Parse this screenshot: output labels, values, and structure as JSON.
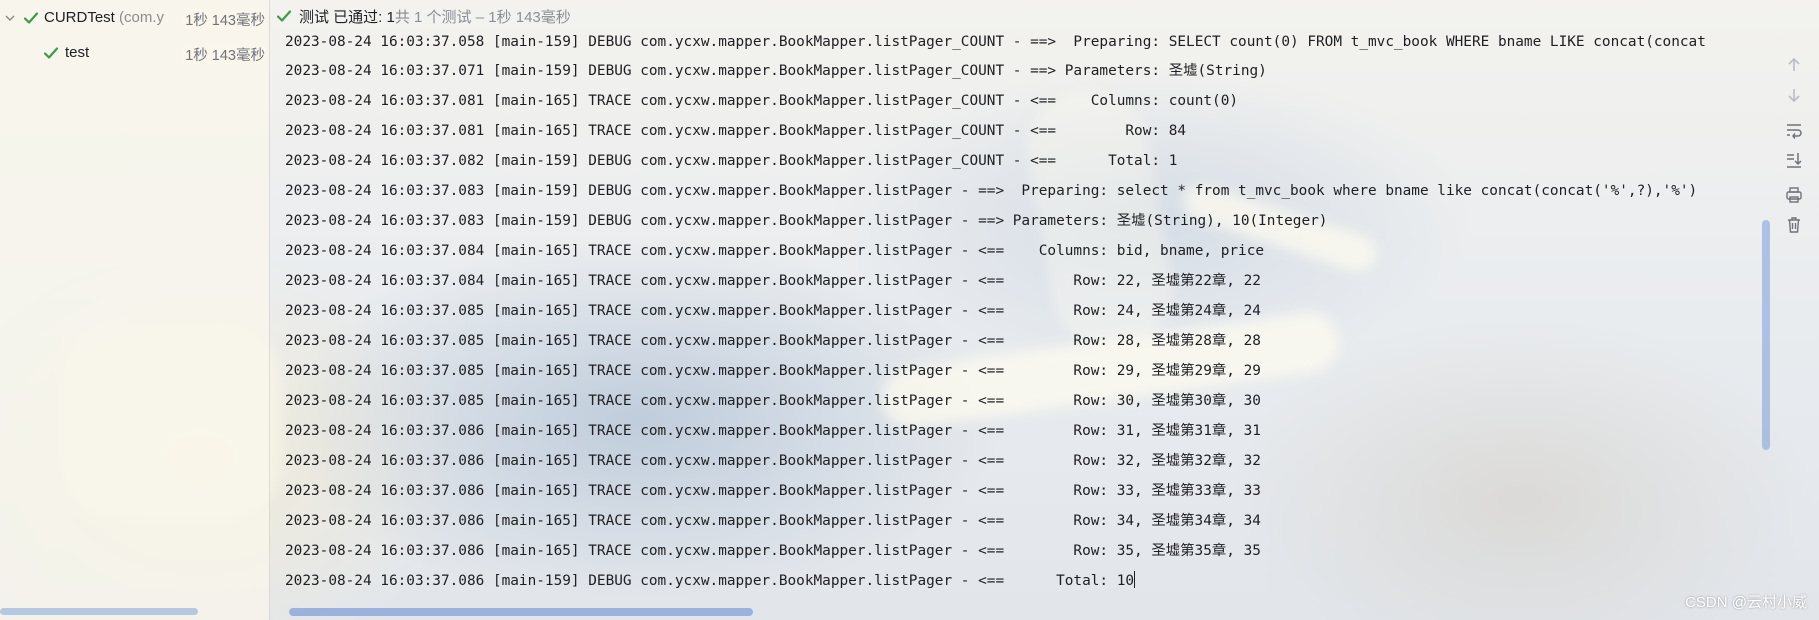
{
  "test_tree": {
    "root": {
      "name": "CURDTest",
      "package": "(com.y",
      "time": "1秒 143毫秒"
    },
    "child": {
      "name": "test",
      "time": "1秒 143毫秒"
    }
  },
  "status_bar": {
    "label": "测试 已通过: 1",
    "summary": "共 1 个测试 – 1秒 143毫秒"
  },
  "console": {
    "lines": [
      "2023-08-24 16:03:37.058 [main-159] DEBUG com.ycxw.mapper.BookMapper.listPager_COUNT - ==>  Preparing: SELECT count(0) FROM t_mvc_book WHERE bname LIKE concat(concat",
      "2023-08-24 16:03:37.071 [main-159] DEBUG com.ycxw.mapper.BookMapper.listPager_COUNT - ==> Parameters: 圣墟(String)",
      "2023-08-24 16:03:37.081 [main-165] TRACE com.ycxw.mapper.BookMapper.listPager_COUNT - <==    Columns: count(0)",
      "2023-08-24 16:03:37.081 [main-165] TRACE com.ycxw.mapper.BookMapper.listPager_COUNT - <==        Row: 84",
      "2023-08-24 16:03:37.082 [main-159] DEBUG com.ycxw.mapper.BookMapper.listPager_COUNT - <==      Total: 1",
      "2023-08-24 16:03:37.083 [main-159] DEBUG com.ycxw.mapper.BookMapper.listPager - ==>  Preparing: select * from t_mvc_book where bname like concat(concat('%',?),'%')",
      "2023-08-24 16:03:37.083 [main-159] DEBUG com.ycxw.mapper.BookMapper.listPager - ==> Parameters: 圣墟(String), 10(Integer)",
      "2023-08-24 16:03:37.084 [main-165] TRACE com.ycxw.mapper.BookMapper.listPager - <==    Columns: bid, bname, price",
      "2023-08-24 16:03:37.084 [main-165] TRACE com.ycxw.mapper.BookMapper.listPager - <==        Row: 22, 圣墟第22章, 22",
      "2023-08-24 16:03:37.085 [main-165] TRACE com.ycxw.mapper.BookMapper.listPager - <==        Row: 24, 圣墟第24章, 24",
      "2023-08-24 16:03:37.085 [main-165] TRACE com.ycxw.mapper.BookMapper.listPager - <==        Row: 28, 圣墟第28章, 28",
      "2023-08-24 16:03:37.085 [main-165] TRACE com.ycxw.mapper.BookMapper.listPager - <==        Row: 29, 圣墟第29章, 29",
      "2023-08-24 16:03:37.085 [main-165] TRACE com.ycxw.mapper.BookMapper.listPager - <==        Row: 30, 圣墟第30章, 30",
      "2023-08-24 16:03:37.086 [main-165] TRACE com.ycxw.mapper.BookMapper.listPager - <==        Row: 31, 圣墟第31章, 31",
      "2023-08-24 16:03:37.086 [main-165] TRACE com.ycxw.mapper.BookMapper.listPager - <==        Row: 32, 圣墟第32章, 32",
      "2023-08-24 16:03:37.086 [main-165] TRACE com.ycxw.mapper.BookMapper.listPager - <==        Row: 33, 圣墟第33章, 33",
      "2023-08-24 16:03:37.086 [main-165] TRACE com.ycxw.mapper.BookMapper.listPager - <==        Row: 34, 圣墟第34章, 34",
      "2023-08-24 16:03:37.086 [main-165] TRACE com.ycxw.mapper.BookMapper.listPager - <==        Row: 35, 圣墟第35章, 35",
      "2023-08-24 16:03:37.086 [main-159] DEBUG com.ycxw.mapper.BookMapper.listPager - <==      Total: 10"
    ]
  },
  "toolbar": {
    "icons": [
      "arrow-up-icon",
      "arrow-down-icon",
      "soft-wrap-icon",
      "scroll-to-end-icon",
      "print-icon",
      "trash-icon"
    ]
  },
  "watermark": "CSDN @云村小威",
  "colors": {
    "check_green": "#3d9b45",
    "scrollbar": "#8aa6dc"
  }
}
